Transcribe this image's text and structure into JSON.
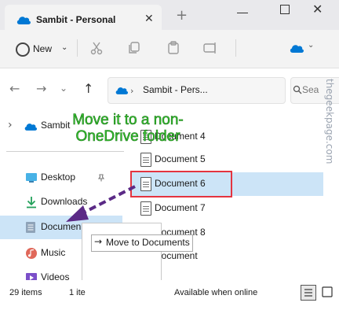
{
  "window": {
    "tab_title": "Sambit - Personal",
    "new_tab": "+",
    "close_tab": "✕",
    "minimize": "—",
    "close": "✕"
  },
  "toolbar": {
    "new_label": "New",
    "new_chevron": "⌄",
    "icons": [
      "cut-icon",
      "copy-icon",
      "paste-icon",
      "rename-icon",
      "onedrive-icon"
    ]
  },
  "navigation": {
    "back": "←",
    "forward": "→",
    "down": "⌄",
    "up": "↑",
    "address": "Sambit - Pers...",
    "address_chevron": "›",
    "search_placeholder": "Sea"
  },
  "sidebar": {
    "expand": "›",
    "onedrive": "Sambit",
    "items": [
      {
        "label": "Desktop",
        "icon": "desktop-icon",
        "pinned": true
      },
      {
        "label": "Downloads",
        "icon": "download-icon",
        "pinned": true
      },
      {
        "label": "Documen",
        "icon": "documents-icon",
        "pinned": true
      },
      {
        "label": "Music",
        "icon": "music-icon",
        "pinned": false
      },
      {
        "label": "Videos",
        "icon": "videos-icon",
        "pinned": false
      }
    ]
  },
  "files": [
    {
      "name": "Document 4"
    },
    {
      "name": "Document 5"
    },
    {
      "name": "Document 6",
      "selected": true
    },
    {
      "name": "Document 7"
    },
    {
      "name": "Document 8"
    },
    {
      "name": "Document"
    }
  ],
  "drag": {
    "tooltip": "Move to Documents",
    "arrow": "→"
  },
  "status": {
    "items": "29 items",
    "item2": "1 ite",
    "online": "Available when online"
  },
  "annotation": {
    "line1": "Move it to a non-",
    "line2": "OneDrive folder"
  },
  "watermark": "thegeekpage.com",
  "colors": {
    "accent": "#0078d4",
    "selection": "#cce4f7",
    "highlight_box": "#e4343f",
    "annotation_text": "#36c431",
    "annotation_arrow": "#5b2a86"
  }
}
